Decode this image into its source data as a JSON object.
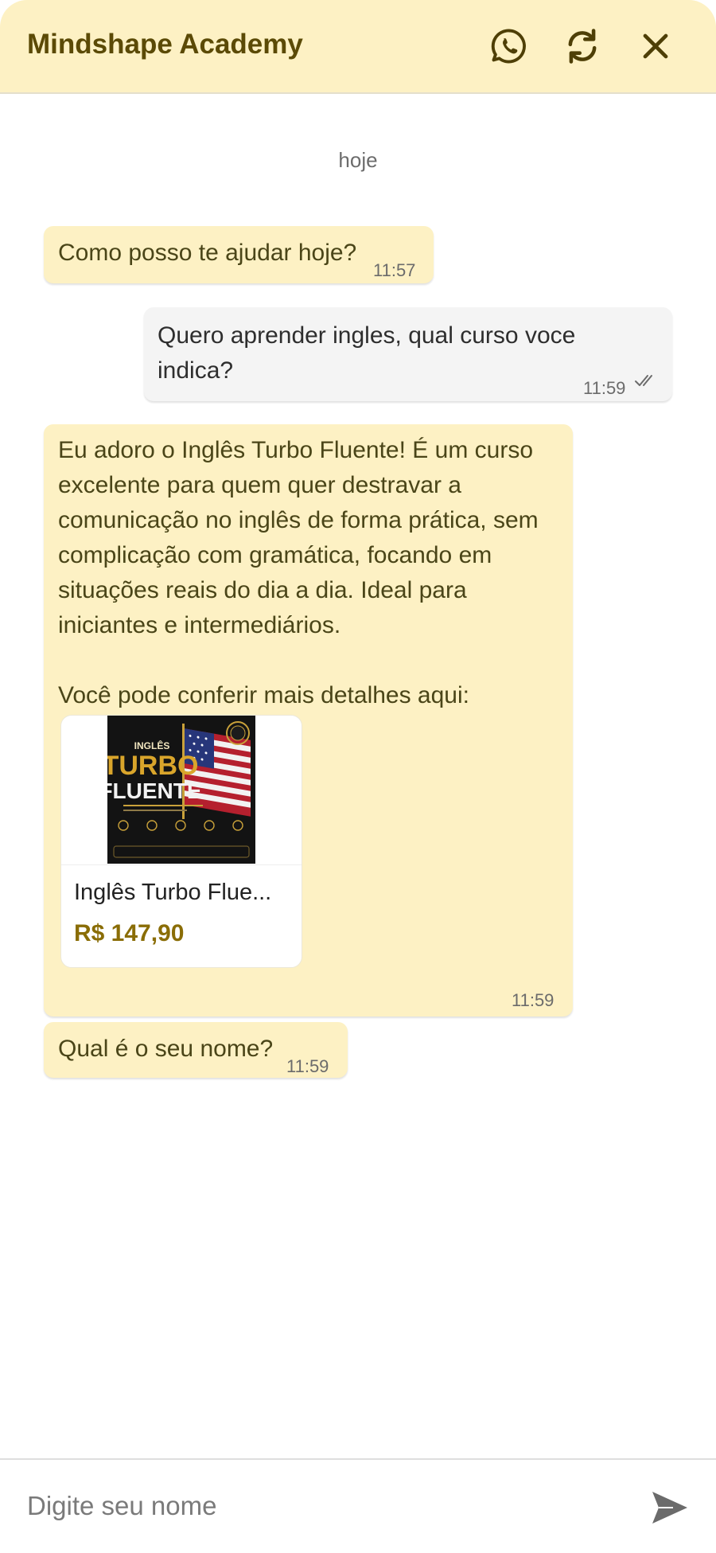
{
  "header": {
    "title": "Mindshape Academy",
    "icons": [
      "whatsapp-icon",
      "refresh-icon",
      "close-icon"
    ]
  },
  "chat": {
    "date_label": "hoje",
    "messages": [
      {
        "sender": "bot",
        "text": "Como posso te ajudar hoje?",
        "time": "11:57"
      },
      {
        "sender": "user",
        "text": "Quero aprender ingles, qual curso voce indica?",
        "time": "11:59",
        "status": "read"
      },
      {
        "sender": "bot",
        "text": "Eu adoro o Inglês Turbo Fluente! É um curso excelente para quem quer destravar a comunicação no inglês de forma prática, sem complicação com gramática, focando em situações reais do dia a dia. Ideal para iniciantes e intermediários.\n\nVocê pode conferir mais detalhes aqui:",
        "time": "11:59",
        "product": {
          "name": "Inglês Turbo Flue...",
          "price": "R$ 147,90",
          "cover": {
            "top": "INGLÊS",
            "word1": "TURBO",
            "word2": "FLUENTE"
          }
        }
      },
      {
        "sender": "bot",
        "text": "Qual é o seu nome?",
        "time": "11:59"
      }
    ]
  },
  "composer": {
    "placeholder": "Digite seu nome",
    "send_icon": "send-icon"
  },
  "colors": {
    "header_bg": "#fdf1c4",
    "bot_bubble": "#fdf1c4",
    "user_bubble": "#f4f4f4",
    "accent": "#5b4a06",
    "price": "#8a6d06"
  }
}
